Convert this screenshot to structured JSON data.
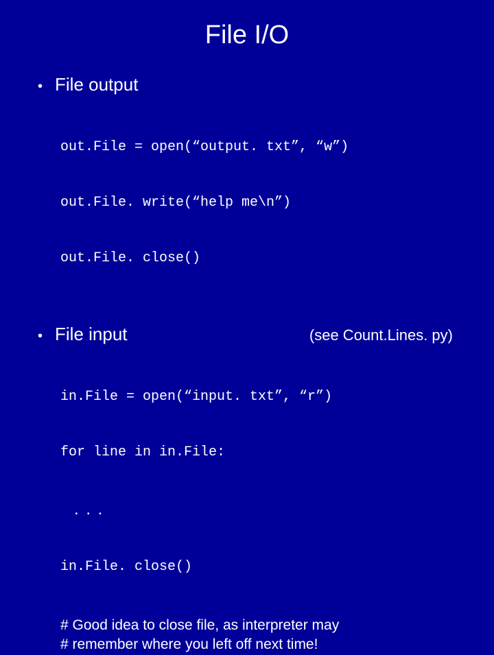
{
  "title": "File I/O",
  "bullets": {
    "output": "File output",
    "input": "File input",
    "aside": "(see Count.Lines. py)"
  },
  "code": {
    "out1": "out.File = open(“output. txt”, “w”)",
    "out2": "out.File. write(“help me\\n”)",
    "out3": "out.File. close()",
    "in1": "in.File = open(“input. txt”, “r”)",
    "in2": "for line in in.File:",
    "ellipsis": ". . .",
    "in3": "in.File. close()"
  },
  "comments": {
    "c1": "# Good idea to close file, as interpreter may",
    "c2": "# remember where you left off next time!"
  }
}
